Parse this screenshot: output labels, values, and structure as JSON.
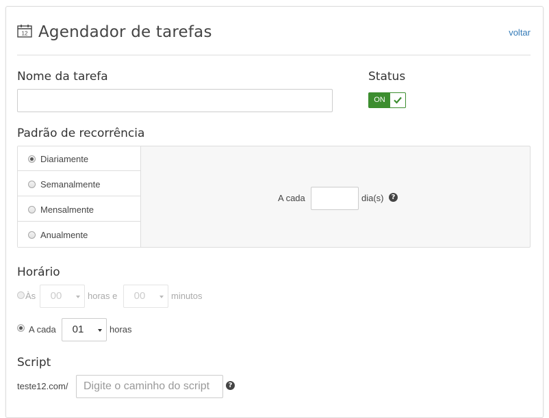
{
  "header": {
    "title": "Agendador de tarefas",
    "back_label": "voltar",
    "icon_text": "12"
  },
  "task_name": {
    "label": "Nome da tarefa",
    "value": ""
  },
  "status": {
    "label": "Status",
    "toggle_text": "ON",
    "enabled": true
  },
  "recurrence": {
    "label": "Padrão de recorrência",
    "options": [
      {
        "label": "Diariamente",
        "selected": true
      },
      {
        "label": "Semanalmente",
        "selected": false
      },
      {
        "label": "Mensalmente",
        "selected": false
      },
      {
        "label": "Anualmente",
        "selected": false
      }
    ],
    "detail": {
      "prefix": "A cada",
      "value": "",
      "suffix": "dia(s)"
    }
  },
  "schedule": {
    "label": "Horário",
    "at": {
      "label": "Às",
      "hours_value": "00",
      "hours_suffix": "horas e",
      "minutes_value": "00",
      "minutes_suffix": "minutos",
      "selected": false
    },
    "every": {
      "label": "A cada",
      "value": "01",
      "suffix": "horas",
      "selected": true
    }
  },
  "script": {
    "label": "Script",
    "prefix": "teste12.com/",
    "placeholder": "Digite o caminho do script",
    "value": ""
  },
  "colors": {
    "accent_green": "#3c8d2f",
    "link_blue": "#337ab7"
  }
}
